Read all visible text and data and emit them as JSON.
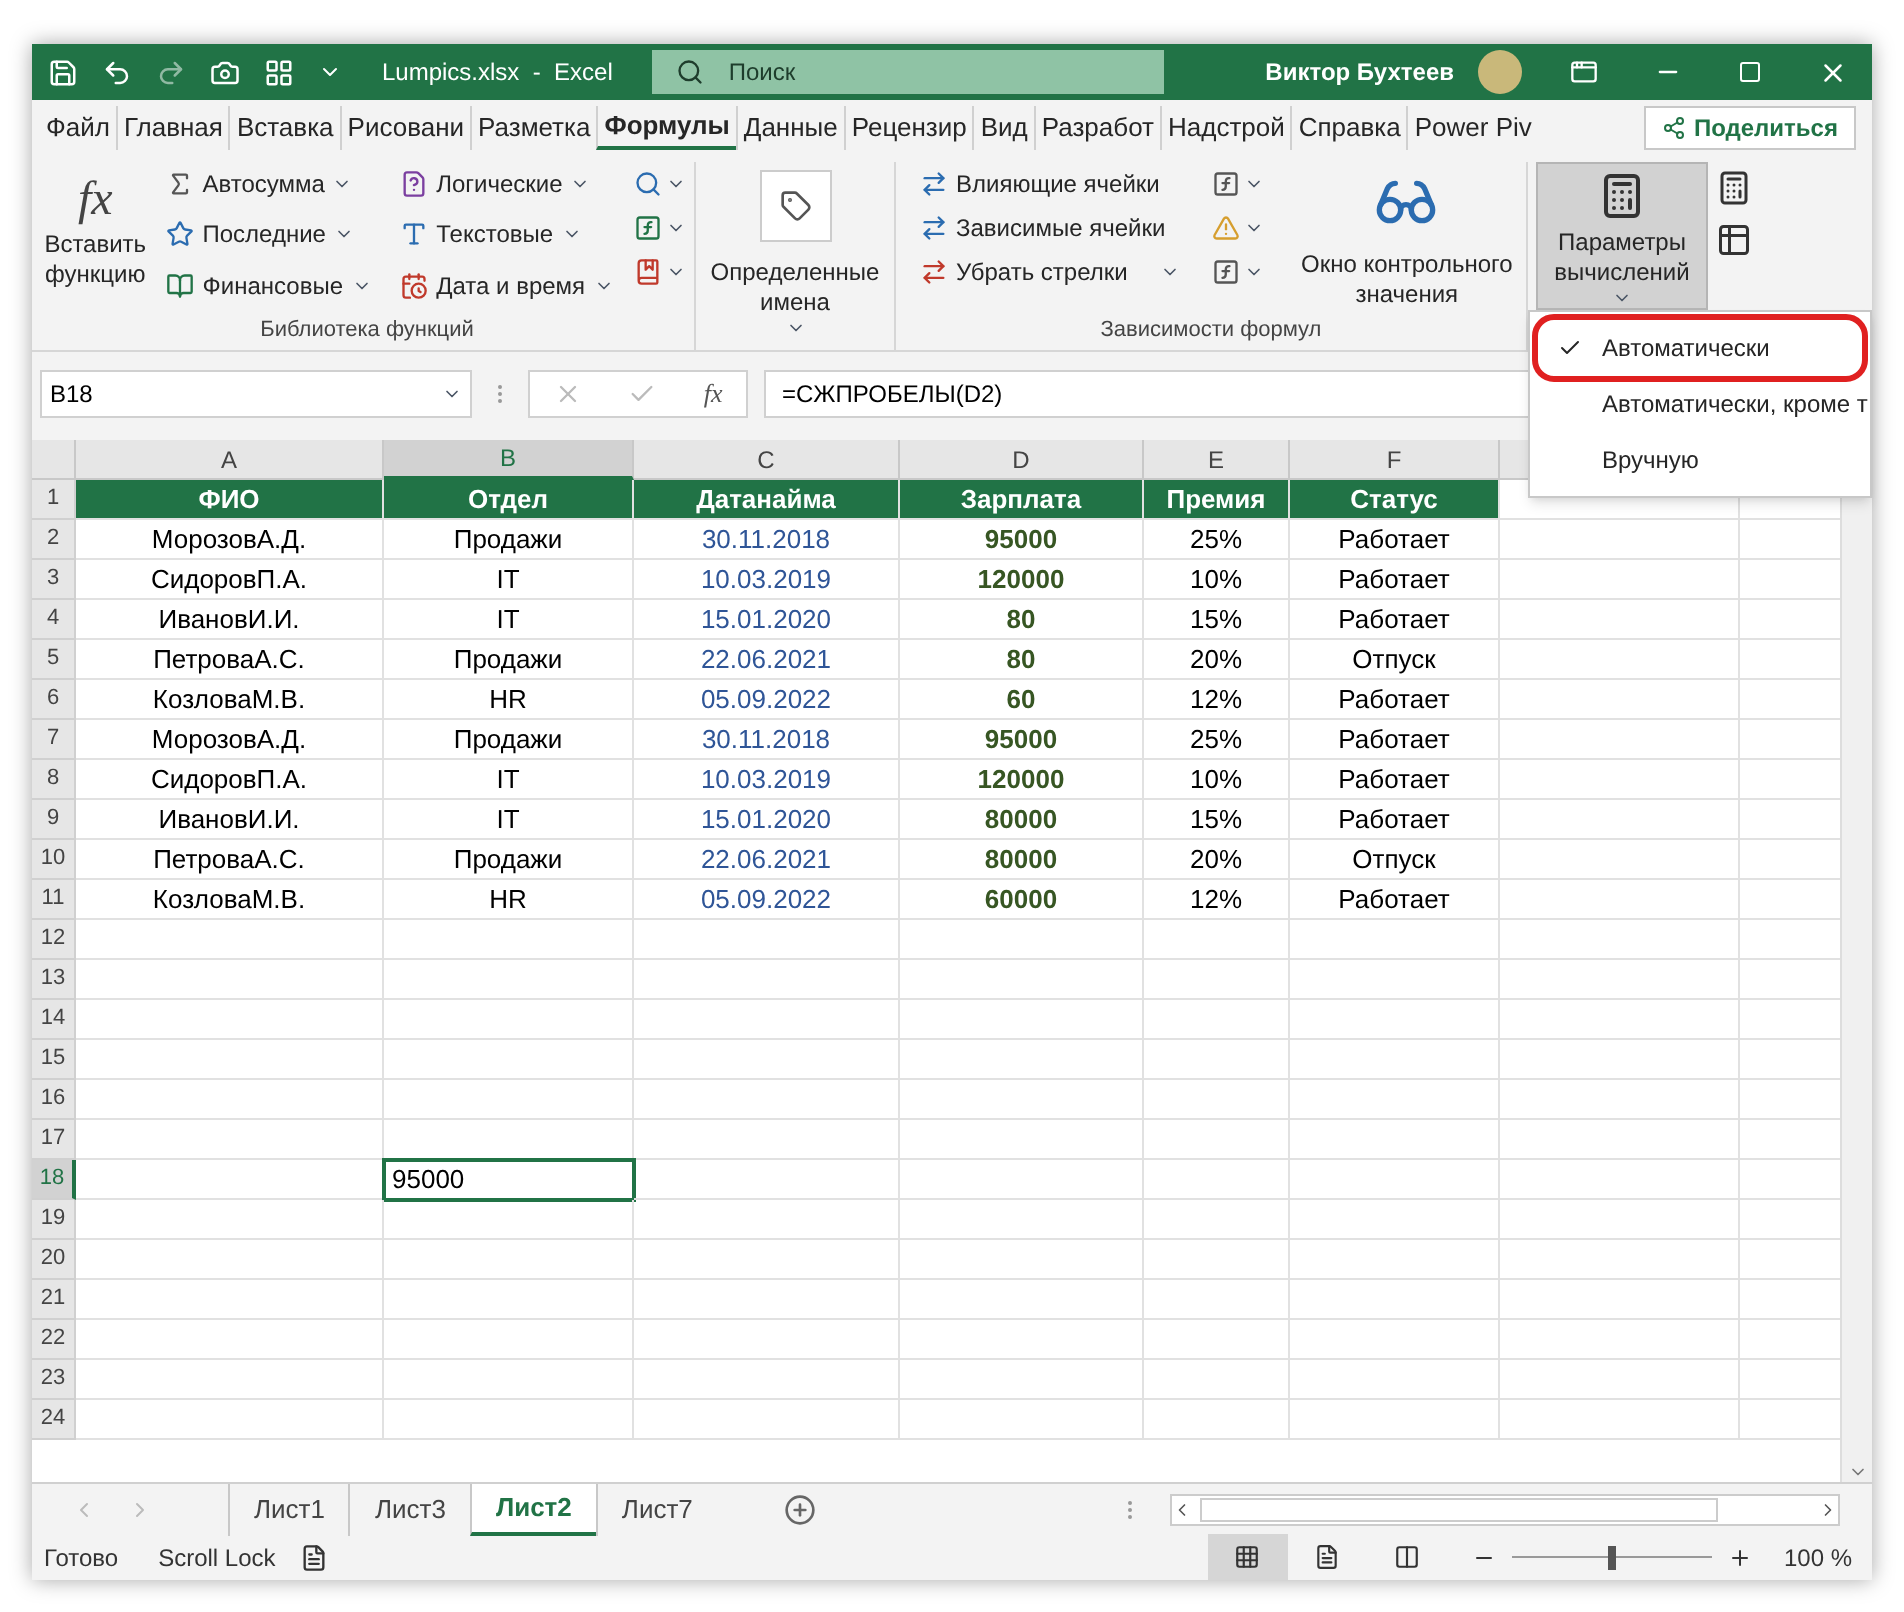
{
  "title_bar": {
    "file_title": "Lumpics.xlsx  -  Excel",
    "search": {
      "placeholder": "Поиск"
    },
    "user": "Виктор Бухтеев"
  },
  "ribbon_tabs": [
    {
      "label": "Файл",
      "selected": false
    },
    {
      "label": "Главная",
      "selected": false
    },
    {
      "label": "Вставка",
      "selected": false
    },
    {
      "label": "Рисовани",
      "selected": false
    },
    {
      "label": "Разметка",
      "selected": false
    },
    {
      "label": "Формулы",
      "selected": true
    },
    {
      "label": "Данные",
      "selected": false
    },
    {
      "label": "Рецензир",
      "selected": false
    },
    {
      "label": "Вид",
      "selected": false
    },
    {
      "label": "Разработ",
      "selected": false
    },
    {
      "label": "Надстрой",
      "selected": false
    },
    {
      "label": "Справка",
      "selected": false
    },
    {
      "label": "Power Piv",
      "selected": false
    }
  ],
  "share_button": "Поделиться",
  "function_library": {
    "label": "Библиотека функций",
    "insert_function": {
      "glyph": "fx",
      "label": "Вставить функцию"
    },
    "commands": [
      "Автосумма",
      "Последние",
      "Финансовые",
      "Логические",
      "Текстовые",
      "Дата и время"
    ]
  },
  "defined_names": "Определенные имена",
  "formula_auditing": {
    "label": "Зависимости формул",
    "commands": [
      "Влияющие ячейки",
      "Зависимые ячейки",
      "Убрать стрелки"
    ],
    "watch_window": "Окно контрольного значения"
  },
  "calculation_options": {
    "label": "Параметры вычислений",
    "expanded": true
  },
  "calculation_menu": [
    {
      "label": "Автоматически",
      "checked": true,
      "highlighted": true
    },
    {
      "label": "Автоматически, кроме т",
      "checked": false,
      "highlighted": false
    },
    {
      "label": "Вручную",
      "checked": false,
      "highlighted": false
    }
  ],
  "name_box": "B18",
  "formula_bar": {
    "glyph": "fx",
    "formula": "=СЖПРОБЕЛЫ(D2)"
  },
  "columns": [
    {
      "letter": "A",
      "selected": false,
      "kind": "text"
    },
    {
      "letter": "B",
      "selected": true,
      "kind": "text"
    },
    {
      "letter": "C",
      "selected": false,
      "kind": "date"
    },
    {
      "letter": "D",
      "selected": false,
      "kind": "amount"
    },
    {
      "letter": "E",
      "selected": false,
      "kind": "text"
    },
    {
      "letter": "F",
      "selected": false,
      "kind": "text"
    },
    {
      "kind": "text"
    },
    {
      "kind": "text"
    }
  ],
  "rows": [
    {
      "number": "1",
      "kind": "header",
      "selected": false,
      "cells": [
        "ФИО",
        "Отдел",
        "Датанайма",
        "Зарплата",
        "Премия",
        "Статус"
      ]
    },
    {
      "number": "2",
      "kind": "data",
      "selected": false,
      "cells": [
        "МорозовА.Д.",
        "Продажи",
        "30.11.2018",
        "95000",
        "25%",
        "Работает"
      ]
    },
    {
      "number": "3",
      "kind": "data",
      "selected": false,
      "cells": [
        "СидоровП.А.",
        "IT",
        "10.03.2019",
        "120000",
        "10%",
        "Работает"
      ]
    },
    {
      "number": "4",
      "kind": "data",
      "selected": false,
      "cells": [
        "ИвановИ.И.",
        "IT",
        "15.01.2020",
        "80",
        "15%",
        "Работает"
      ]
    },
    {
      "number": "5",
      "kind": "data",
      "selected": false,
      "cells": [
        "ПетроваА.С.",
        "Продажи",
        "22.06.2021",
        "80",
        "20%",
        "Отпуск"
      ]
    },
    {
      "number": "6",
      "kind": "data",
      "selected": false,
      "cells": [
        "КозловаМ.В.",
        "HR",
        "05.09.2022",
        "60",
        "12%",
        "Работает"
      ]
    },
    {
      "number": "7",
      "kind": "data",
      "selected": false,
      "cells": [
        "МорозовА.Д.",
        "Продажи",
        "30.11.2018",
        "95000",
        "25%",
        "Работает"
      ]
    },
    {
      "number": "8",
      "kind": "data",
      "selected": false,
      "cells": [
        "СидоровП.А.",
        "IT",
        "10.03.2019",
        "120000",
        "10%",
        "Работает"
      ]
    },
    {
      "number": "9",
      "kind": "data",
      "selected": false,
      "cells": [
        "ИвановИ.И.",
        "IT",
        "15.01.2020",
        "80000",
        "15%",
        "Работает"
      ]
    },
    {
      "number": "10",
      "kind": "data",
      "selected": false,
      "cells": [
        "ПетроваА.С.",
        "Продажи",
        "22.06.2021",
        "80000",
        "20%",
        "Отпуск"
      ]
    },
    {
      "number": "11",
      "kind": "data",
      "selected": false,
      "cells": [
        "КозловаМ.В.",
        "HR",
        "05.09.2022",
        "60000",
        "12%",
        "Работает"
      ]
    },
    {
      "number": "12",
      "kind": "plain",
      "selected": false
    },
    {
      "number": "13",
      "kind": "plain",
      "selected": false
    },
    {
      "number": "14",
      "kind": "plain",
      "selected": false
    },
    {
      "number": "15",
      "kind": "plain",
      "selected": false
    },
    {
      "number": "16",
      "kind": "plain",
      "selected": false
    },
    {
      "number": "17",
      "kind": "plain",
      "selected": false
    },
    {
      "number": "18",
      "kind": "plain",
      "selected": true,
      "cells": [
        null,
        "95000"
      ]
    },
    {
      "number": "19",
      "kind": "plain",
      "selected": false
    },
    {
      "number": "20",
      "kind": "plain",
      "selected": false
    },
    {
      "number": "21",
      "kind": "plain",
      "selected": false
    },
    {
      "number": "22",
      "kind": "plain",
      "selected": false
    },
    {
      "number": "23",
      "kind": "plain",
      "selected": false
    },
    {
      "number": "24",
      "kind": "plain",
      "selected": false
    }
  ],
  "sheet_tabs": [
    {
      "label": "Лист1",
      "selected": false
    },
    {
      "label": "Лист3",
      "selected": false
    },
    {
      "label": "Лист2",
      "selected": true
    },
    {
      "label": "Лист7",
      "selected": false
    }
  ],
  "status_bar": {
    "status": "Готово",
    "scroll_lock": "Scroll Lock",
    "views": [
      {
        "kind": "normal",
        "selected": true
      },
      {
        "kind": "page_layout",
        "selected": false
      },
      {
        "kind": "page_break",
        "selected": false
      }
    ],
    "zoom": {
      "level": 0.5,
      "reading": "100 %"
    }
  }
}
